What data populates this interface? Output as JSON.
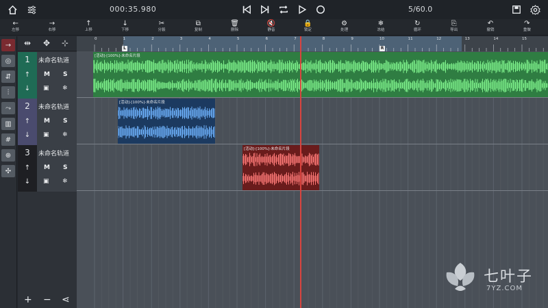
{
  "topbar": {
    "time": "000:35.980",
    "pages": "5/60.0",
    "icons": [
      "home-icon",
      "sliders-icon",
      "skip-start-icon",
      "skip-end-icon",
      "loop-icon",
      "play-icon",
      "record-icon",
      "save-icon",
      "settings-icon"
    ]
  },
  "toolbar": {
    "items": [
      {
        "label": "左移",
        "glyph": "←"
      },
      {
        "label": "右移",
        "glyph": "→"
      },
      {
        "label": "上移",
        "glyph": "↑"
      },
      {
        "label": "下移",
        "glyph": "↓"
      },
      {
        "label": "分裂",
        "glyph": "✂"
      },
      {
        "label": "复制",
        "glyph": "⧉"
      },
      {
        "label": "删除",
        "glyph": "🗑"
      },
      {
        "label": "静音",
        "glyph": "🔇"
      },
      {
        "label": "锁定",
        "glyph": "🔒"
      },
      {
        "label": "处理",
        "glyph": "⚙"
      },
      {
        "label": "冻结",
        "glyph": "❄"
      },
      {
        "label": "循环",
        "glyph": "↻"
      },
      {
        "label": "导出",
        "glyph": "⎘"
      },
      {
        "label": "撤销",
        "glyph": "↶"
      },
      {
        "label": "重做",
        "glyph": "↷"
      }
    ]
  },
  "ruler": {
    "ticks": [
      "0",
      "1",
      "2",
      "3",
      "4",
      "5",
      "6",
      "7",
      "8",
      "9",
      "10",
      "11",
      "12",
      "13",
      "14",
      "15"
    ],
    "left_marker": "L",
    "right_marker": "R"
  },
  "tracks": [
    {
      "number": "1",
      "name": "未命名轨道",
      "mute": "M",
      "solo": "S",
      "color": "#1f6b55",
      "clip_label": "[活动]-[100%]-未命名片段",
      "clip_color": "#2f7d42",
      "wave_color": "#7ff28c"
    },
    {
      "number": "2",
      "name": "未命名轨道",
      "mute": "M",
      "solo": "S",
      "color": "#4a4b6e",
      "clip_label": "[活动]-[100%]-未命名片段",
      "clip_color": "#1c3a60",
      "wave_color": "#6fb4ff"
    },
    {
      "number": "3",
      "name": "未命名轨道",
      "mute": "M",
      "solo": "S",
      "color": "#1e1f23",
      "clip_label": "[活动]-[100%]-未命名片段",
      "clip_color": "#6a1c1c",
      "wave_color": "#ff7a78"
    }
  ],
  "colors": {
    "accent_red": "#d9443f",
    "background": "#262a30"
  },
  "watermark": {
    "title": "七叶子",
    "subtitle": "7YZ.COM"
  }
}
